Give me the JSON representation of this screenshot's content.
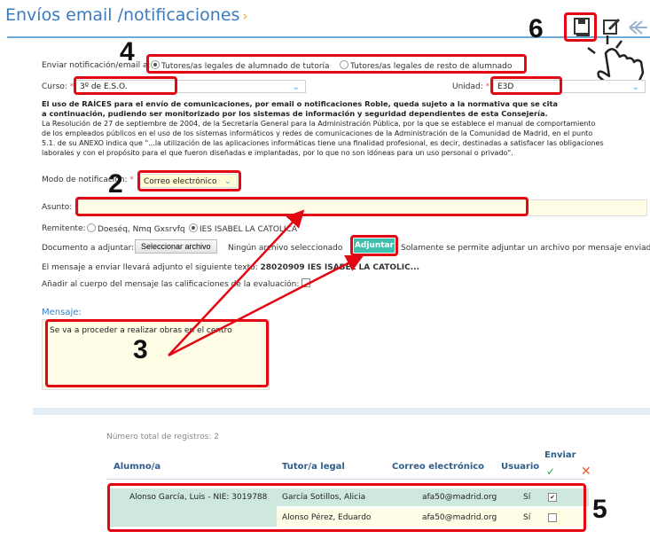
{
  "header": {
    "title": "Envíos email /notificaciones",
    "title_chevron": "›"
  },
  "form": {
    "send_label": "Enviar notificación/email a:",
    "send_options": [
      {
        "label": "Tutores/as legales de alumnado de tutoría",
        "selected": true
      },
      {
        "label": "Tutores/as legales de resto de alumnado",
        "selected": false
      }
    ],
    "curso_label": "Curso:",
    "curso_value": "3º de E.S.O.",
    "unidad_label": "Unidad:",
    "unidad_value": "E3D",
    "notice_bold_1": "El uso de RAÍCES para el envío de comunicaciones, por email o notificaciones Roble, queda sujeto a la normativa que se cita",
    "notice_bold_2": "a continuación, pudiendo ser monitorizado por los sistemas de información y seguridad dependientes de esta Consejería.",
    "notice_text_1": "La Resolución de 27 de septiembre de 2004, de la Secretaría General para la Administración Pública, por la que se establece el manual de comportamiento",
    "notice_text_2": "de los empleados públicos en el uso de los sistemas informáticos y redes de comunicaciones de la Administración de la Comunidad de Madrid, en el punto",
    "notice_text_3": "5.1. de su ANEXO indica que \"...la utilización de las aplicaciones informáticas tiene una finalidad profesional, es decir, destinadas a satisfacer las obligaciones",
    "notice_text_4": "laborales y con el propósito para el que fueron diseñadas e implantadas, por lo que no son idóneas para un uso personal o privado\".",
    "modo_label": "Modo de notificación:",
    "modo_value": "Correo electrónico",
    "asunto_label": "Asunto:",
    "remitente_label": "Remitente:",
    "remitente_options": [
      {
        "label": "Doeséq, Nmq Gxsrvfq",
        "selected": false
      },
      {
        "label": "IES ISABEL LA CATOLICA",
        "selected": true
      }
    ],
    "documento_label": "Documento a adjuntar:",
    "select_file_button": "Seleccionar archivo",
    "no_file_text": "Ningún archivo seleccionado",
    "attach_button": "Adjuntar",
    "attach_note": "Solamente se permite adjuntar un archivo por mensaje enviado",
    "attached_text_label": "El mensaje a enviar llevará adjunto el siguiente texto:",
    "attached_text_value": "28020909 IES ISABEL LA CATOLIC...",
    "add_grades_label": "Añadir al cuerpo del mensaje las calificaciones de la evaluación:",
    "mensaje_label": "Mensaje:",
    "mensaje_value": "Se va a proceder a realizar obras en el centro"
  },
  "table": {
    "total_label": "Número total de registros: 2",
    "headers": {
      "alumno": "Alumno/a",
      "tutor": "Tutor/a legal",
      "correo": "Correo electrónico",
      "usuario": "Usuario",
      "enviar": "Enviar"
    },
    "rows": [
      {
        "alumno": "Alonso García, Luis - NIE: 3019788",
        "tutor": "García Sotillos, Alicia",
        "correo": "afa50@madrid.org",
        "usuario": "Sí",
        "checked": true
      },
      {
        "alumno": "",
        "tutor": "Alonso Pérez, Eduardo",
        "correo": "afa50@madrid.org",
        "usuario": "Sí",
        "checked": false
      }
    ]
  },
  "callouts": [
    "2",
    "3",
    "4",
    "5",
    "6"
  ],
  "colors": {
    "title": "#3b7bbf",
    "annotation": "#e30613",
    "row_highlight": "#cfe8de",
    "attach_button": "#3fbfae"
  },
  "icons": [
    "save-icon",
    "edit-icon",
    "undo-icon",
    "hand-pointer-icon",
    "check-icon",
    "close-icon",
    "chevron-down-icon"
  ]
}
